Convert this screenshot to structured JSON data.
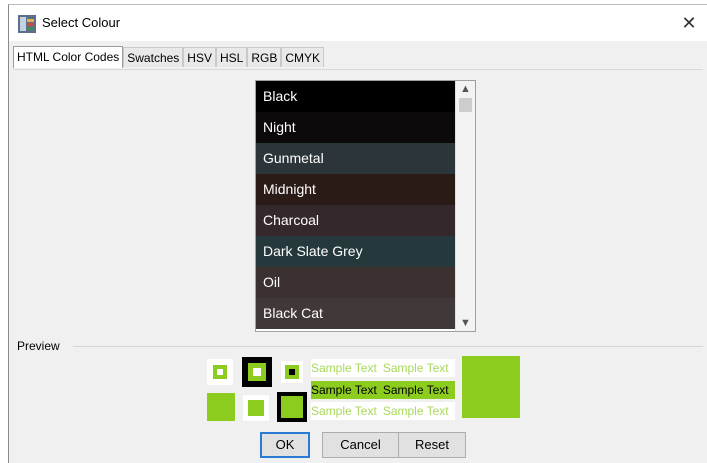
{
  "window": {
    "title": "Select Colour",
    "app_icon": "colour-dialog-icon",
    "close_icon": "close-icon"
  },
  "tabs": [
    {
      "label": "HTML Color Codes",
      "active": true
    },
    {
      "label": "Swatches",
      "active": false
    },
    {
      "label": "HSV",
      "active": false
    },
    {
      "label": "HSL",
      "active": false
    },
    {
      "label": "RGB",
      "active": false
    },
    {
      "label": "CMYK",
      "active": false
    }
  ],
  "colors": {
    "selected": "#8bcc1e",
    "dialog_bg": "#f0f0f0"
  },
  "color_list": [
    {
      "name": "Black",
      "hex": "#000000"
    },
    {
      "name": "Night",
      "hex": "#0c090a"
    },
    {
      "name": "Gunmetal",
      "hex": "#2c3539"
    },
    {
      "name": "Midnight",
      "hex": "#2b1b17"
    },
    {
      "name": "Charcoal",
      "hex": "#34282c"
    },
    {
      "name": "Dark Slate Grey",
      "hex": "#25383c"
    },
    {
      "name": "Oil",
      "hex": "#3b3131"
    },
    {
      "name": "Black Cat",
      "hex": "#413839"
    }
  ],
  "scrollbar": {
    "up_icon": "chevron-up-icon",
    "down_icon": "chevron-down-icon"
  },
  "preview": {
    "label": "Preview",
    "sample_text": "Sample Text"
  },
  "buttons": {
    "ok": "OK",
    "cancel": "Cancel",
    "reset": "Reset"
  }
}
